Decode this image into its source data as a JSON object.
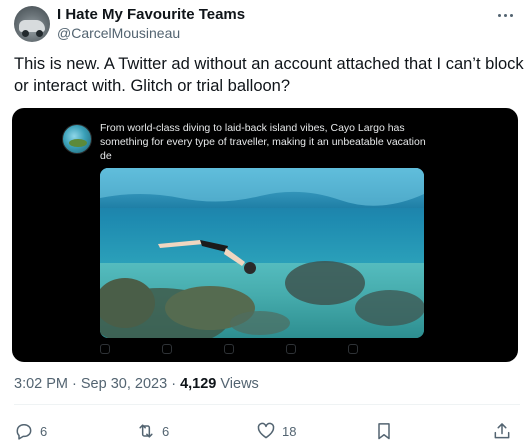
{
  "tweet": {
    "author_name": "I Hate My Favourite Teams",
    "author_handle": "@CarcelMousineau",
    "text_lines": [
      "This is new. A Twitter ad without an account attached that I can’t block",
      "or interact with. Glitch or trial balloon?"
    ]
  },
  "embedded_ad": {
    "text_lines": [
      "From world-class diving to laid-back island vibes, Cayo Largo has",
      "something for every type of traveller, making it an unbeatable vacation",
      "de"
    ]
  },
  "meta": {
    "time": "3:02 PM",
    "sep1": " · ",
    "date": "Sep 30, 2023",
    "sep2": " · ",
    "views_count": "4,129",
    "views_label": " Views"
  },
  "actions": {
    "replies": "6",
    "retweets": "6",
    "likes": "18"
  },
  "icons": [
    "more-icon",
    "reply-icon",
    "retweet-icon",
    "like-icon",
    "bookmark-icon",
    "share-icon"
  ],
  "colors": {
    "text": "#0f1419",
    "secondary": "#536471",
    "media_bg": "#000000"
  }
}
